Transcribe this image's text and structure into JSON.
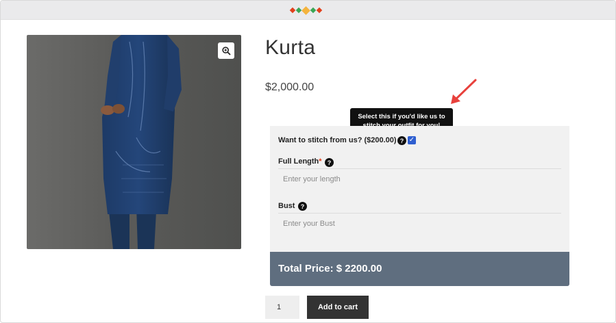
{
  "header": {
    "logo_colors": [
      "#e2401c",
      "#3aa655",
      "#f4b33d",
      "#3aa655",
      "#e2401c"
    ]
  },
  "product": {
    "title": "Kurta",
    "price": "$2,000.00",
    "image_alt_icon": "zoom-in-icon"
  },
  "tooltip": {
    "text": "Select this if you'd like us to stitch your outfit for you!"
  },
  "form": {
    "stitch_label": "Want to stitch from us? ($200.00)",
    "stitch_checked": true,
    "help_glyph": "?",
    "check_glyph": "✓",
    "full_length": {
      "label": "Full Length",
      "required_mark": "*",
      "placeholder": "Enter your length"
    },
    "bust": {
      "label": "Bust",
      "placeholder": "Enter your Bust"
    }
  },
  "total": {
    "label": "Total Price: $ 2200.00"
  },
  "cart": {
    "quantity": "1",
    "add_label": "Add to cart"
  },
  "colors": {
    "total_bar": "#5f6e7f",
    "button": "#333333",
    "annotation_arrow": "#e8413c",
    "checkbox": "#2f5fd0"
  }
}
